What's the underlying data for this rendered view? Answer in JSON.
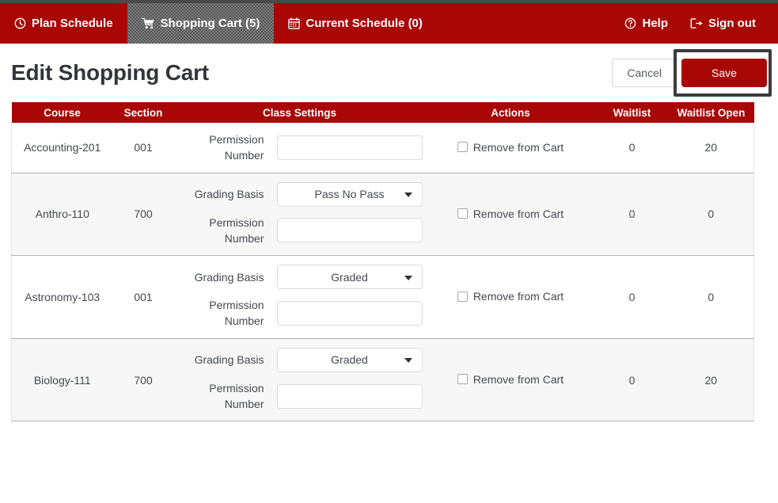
{
  "colors": {
    "brand_red": "#a90606",
    "active_tab_gray": "#555555",
    "focus_outline": "#3b3b3b",
    "row_alt": "#f7f7f7",
    "header_text": "#ffffff"
  },
  "navbar": {
    "left_items": [
      {
        "label": "Plan Schedule",
        "icon": "clock-icon",
        "active": false
      },
      {
        "label": "Shopping Cart (5)",
        "icon": "shopping-cart-icon",
        "active": true
      },
      {
        "label": "Current Schedule (0)",
        "icon": "calendar-icon",
        "active": false
      }
    ],
    "right_items": [
      {
        "label": "Help",
        "icon": "question-circle-icon"
      },
      {
        "label": "Sign out",
        "icon": "sign-out-icon"
      }
    ]
  },
  "page": {
    "title": "Edit Shopping Cart",
    "cancel_label": "Cancel",
    "save_label": "Save"
  },
  "table": {
    "columns": [
      "Course",
      "Section",
      "Class Settings",
      "Actions",
      "Waitlist",
      "Waitlist Open"
    ],
    "labels": {
      "grading_basis": "Grading Basis",
      "permission_number": "Permission Number",
      "remove_from_cart": "Remove from Cart"
    },
    "rows": [
      {
        "course": "Accounting-201",
        "section": "001",
        "has_grading_basis": false,
        "grading_basis": "",
        "permission_number": "",
        "permission_placeholder": "",
        "remove_checked": false,
        "waitlist": "0",
        "waitlist_open": "20"
      },
      {
        "course": "Anthro-110",
        "section": "700",
        "has_grading_basis": true,
        "grading_basis": "Pass No Pass",
        "permission_number": "",
        "permission_placeholder": "",
        "remove_checked": false,
        "waitlist": "0",
        "waitlist_open": "0"
      },
      {
        "course": "Astronomy-103",
        "section": "001",
        "has_grading_basis": true,
        "grading_basis": "Graded",
        "permission_number": "",
        "permission_placeholder": "",
        "remove_checked": false,
        "waitlist": "0",
        "waitlist_open": "0"
      },
      {
        "course": "Biology-111",
        "section": "700",
        "has_grading_basis": true,
        "grading_basis": "Graded",
        "permission_number": "",
        "permission_placeholder": "",
        "remove_checked": false,
        "waitlist": "0",
        "waitlist_open": "20"
      }
    ],
    "grading_basis_options": [
      "Graded",
      "Pass No Pass"
    ]
  }
}
